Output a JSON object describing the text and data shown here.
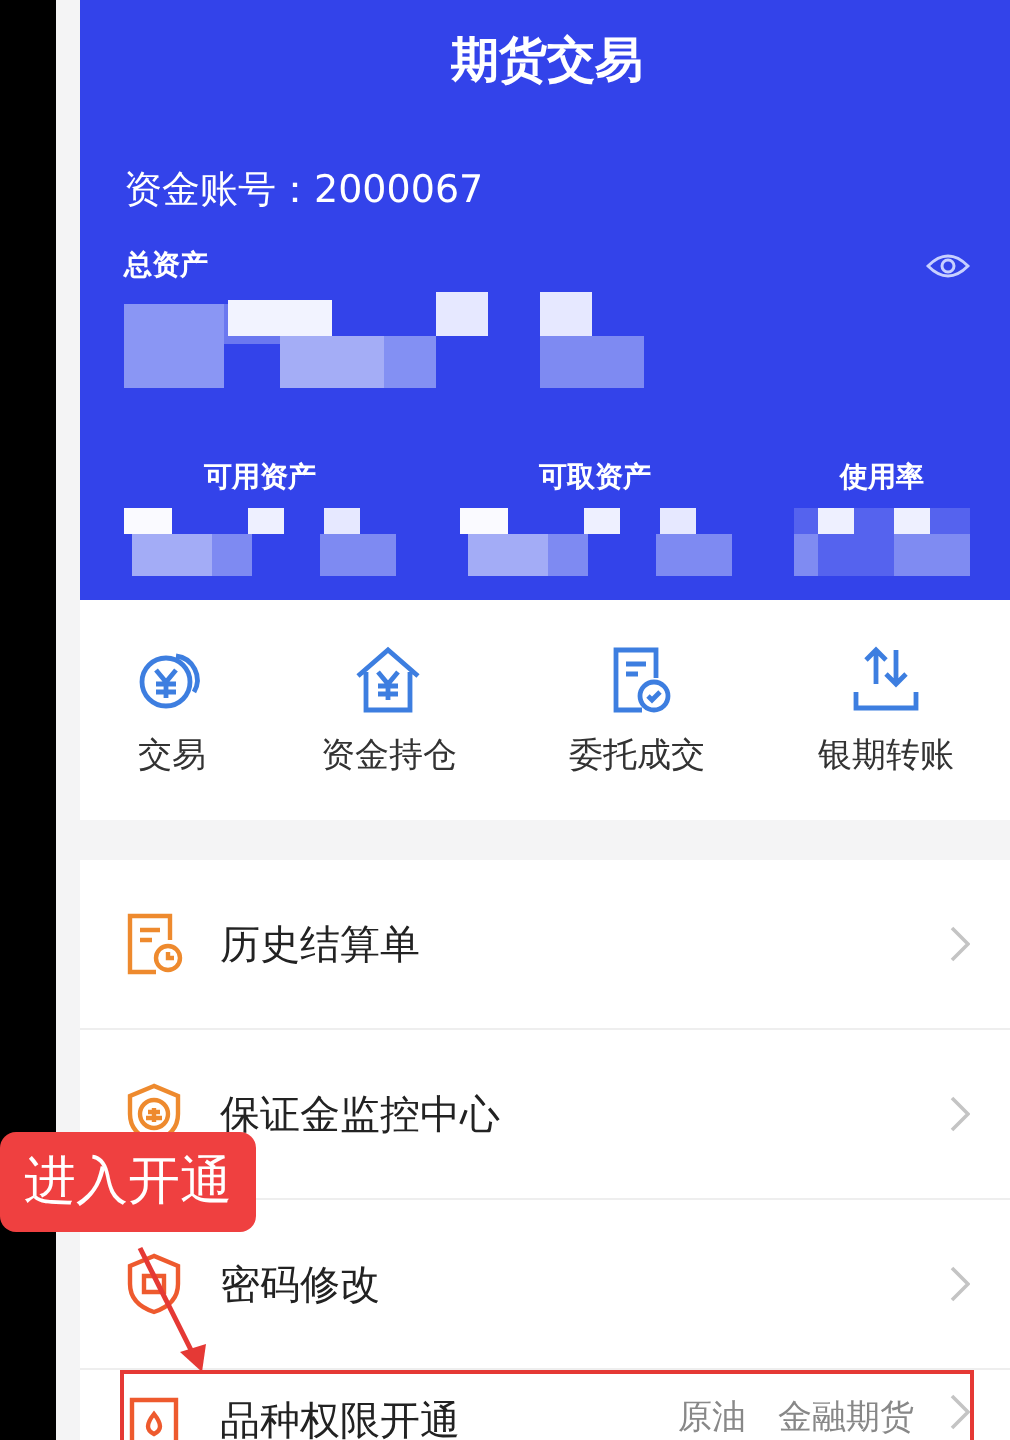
{
  "header": {
    "title": "期货交易",
    "account": "资金账号：2000067",
    "total_assets_label": "总资产",
    "stats": [
      {
        "label": "可用资产"
      },
      {
        "label": "可取资产"
      },
      {
        "label": "使用率"
      }
    ]
  },
  "shortcuts": [
    {
      "label": "交易",
      "kind": "coin"
    },
    {
      "label": "资金持仓",
      "kind": "house"
    },
    {
      "label": "委托成交",
      "kind": "document"
    },
    {
      "label": "银期转账",
      "kind": "transfer"
    }
  ],
  "menu": [
    {
      "label": "历史结算单",
      "kind": "statement",
      "highlighted": false
    },
    {
      "label": "保证金监控中心",
      "kind": "badge",
      "highlighted": false
    },
    {
      "label": "密码修改",
      "kind": "shield",
      "highlighted": false
    },
    {
      "label": "品种权限开通",
      "kind": "permit",
      "tags": [
        "原油",
        "金融期货"
      ],
      "highlighted": true
    }
  ],
  "annotation": {
    "text": "进入开通"
  }
}
